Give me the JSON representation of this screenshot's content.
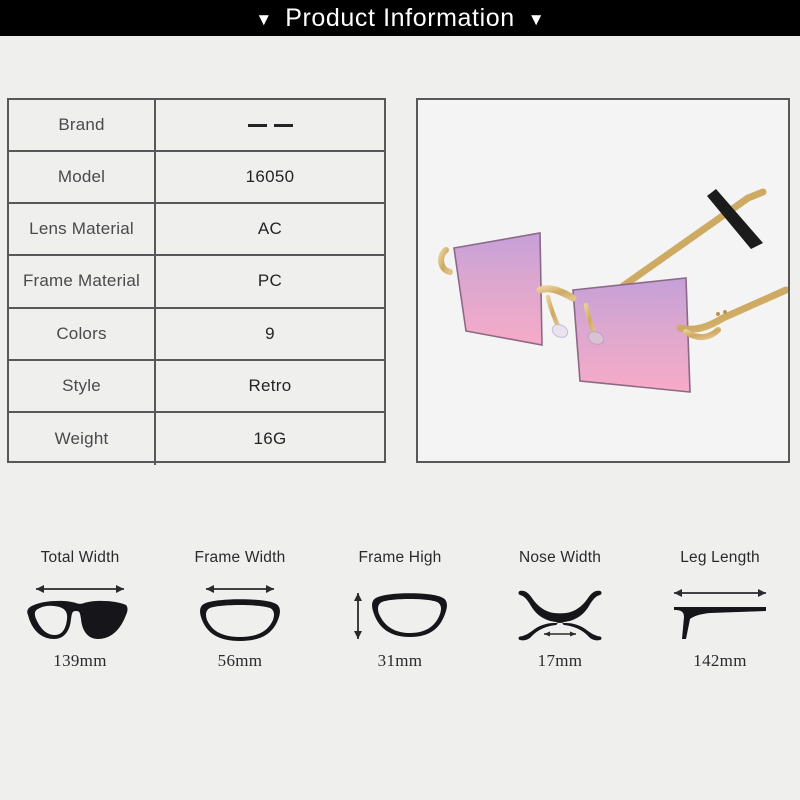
{
  "header": {
    "title": "Product Information",
    "left_marker": "▼",
    "right_marker": "▼"
  },
  "spec_table": {
    "rows": [
      {
        "label": "Brand",
        "value": "— —",
        "is_dashes": true
      },
      {
        "label": "Model",
        "value": "16050",
        "is_dashes": false
      },
      {
        "label": "Lens Material",
        "value": "AC",
        "is_dashes": false
      },
      {
        "label": "Frame Material",
        "value": "PC",
        "is_dashes": false
      },
      {
        "label": "Colors",
        "value": "9",
        "is_dashes": false
      },
      {
        "label": "Style",
        "value": "Retro",
        "is_dashes": false
      },
      {
        "label": "Weight",
        "value": "16G",
        "is_dashes": false
      }
    ]
  },
  "product_image": {
    "description": "rimless rectangular sunglasses, gradient purple-pink lenses, gold metal temples with black tips",
    "lens_gradient_top": "#c9a3d6",
    "lens_gradient_bottom": "#f4a8c4",
    "metal_color": "#d8b978",
    "tip_color": "#1b1b1b",
    "background": "#f4f4f4"
  },
  "measurements": [
    {
      "label": "Total Width",
      "value": "139mm",
      "icon": "full-glasses-width-icon"
    },
    {
      "label": "Frame Width",
      "value": "56mm",
      "icon": "single-lens-width-icon"
    },
    {
      "label": "Frame High",
      "value": "31mm",
      "icon": "single-lens-height-icon"
    },
    {
      "label": "Nose Width",
      "value": "17mm",
      "icon": "nose-bridge-icon"
    },
    {
      "label": "Leg Length",
      "value": "142mm",
      "icon": "temple-arm-icon"
    }
  ],
  "colors": {
    "header_bar": "#000000",
    "page_background": "#efefee",
    "border": "#58585a",
    "text": "#2a2a2c"
  }
}
